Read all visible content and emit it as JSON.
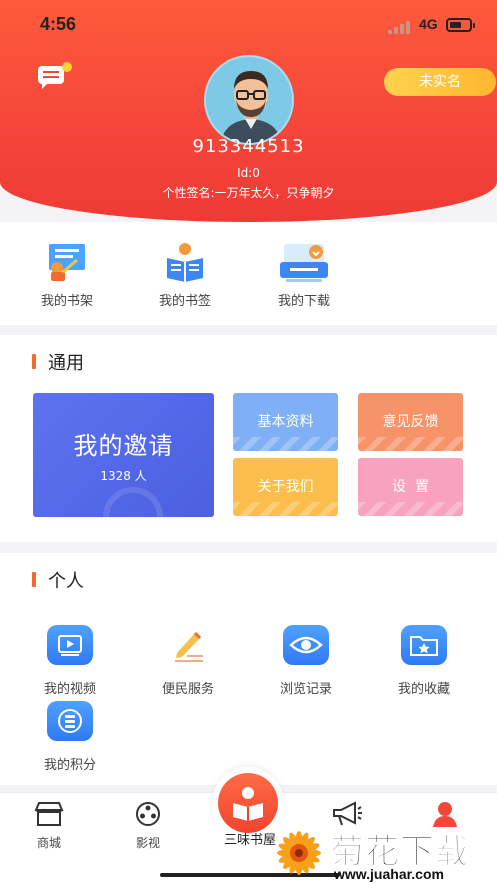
{
  "status_bar": {
    "time": "4:56",
    "network": "4G"
  },
  "header": {
    "verify_label": "未实名",
    "user_id": "913344513",
    "id_line": "Id:0",
    "signature": "个性签名:一万年太久，只争朝夕"
  },
  "quick_links": [
    {
      "label": "我的书架",
      "icon": "bookshelf-icon"
    },
    {
      "label": "我的书签",
      "icon": "bookmark-reader-icon"
    },
    {
      "label": "我的下载",
      "icon": "download-tray-icon"
    }
  ],
  "general": {
    "title": "通用",
    "invite": {
      "label": "我的邀请",
      "count": "1328 人"
    },
    "tiles": [
      {
        "label": "基本资料",
        "color": "#7fb0f5"
      },
      {
        "label": "意见反馈",
        "color": "#f79368"
      },
      {
        "label": "关于我们",
        "color": "#fbbd4b"
      },
      {
        "label": "设  置",
        "color": "#f7a3bf"
      }
    ]
  },
  "personal": {
    "title": "个人",
    "items": [
      {
        "label": "我的视频",
        "icon": "video-icon"
      },
      {
        "label": "便民服务",
        "icon": "pen-edit-icon"
      },
      {
        "label": "浏览记录",
        "icon": "eye-icon"
      },
      {
        "label": "我的收藏",
        "icon": "star-folder-icon"
      },
      {
        "label": "我的积分",
        "icon": "points-coin-icon"
      }
    ]
  },
  "tabbar": {
    "tabs": [
      {
        "label": "商城",
        "icon": "store-icon"
      },
      {
        "label": "影视",
        "icon": "film-reel-icon"
      },
      {
        "label": "三味书屋",
        "icon": "reading-person-icon"
      },
      {
        "label": "",
        "icon": "megaphone-icon"
      },
      {
        "label": "",
        "icon": "person-icon"
      }
    ]
  },
  "watermark": {
    "title": "菊花下载网",
    "url": "www.juahar.com"
  },
  "colors": {
    "brand_red": "#f5473a",
    "accent_orange": "#f26a2d",
    "invite_blue": "#5268e8",
    "icon_blue": "#3b87f5"
  }
}
